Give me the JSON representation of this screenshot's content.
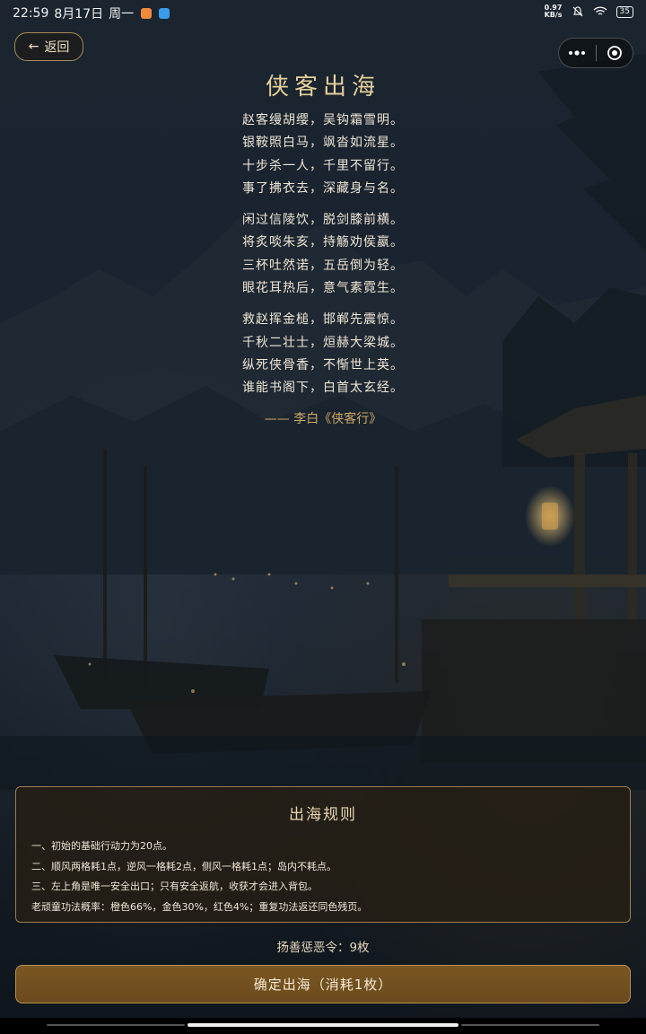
{
  "status_bar": {
    "time": "22:59",
    "date": "8月17日",
    "weekday": "周一",
    "net_speed_value": "0.97",
    "net_speed_unit": "KB/s",
    "battery": "35"
  },
  "header": {
    "back_arrow": "←",
    "back_label": "返回"
  },
  "poem": {
    "title": "侠客出海",
    "stanzas": [
      [
        "赵客缦胡缨，吴钩霜雪明。",
        "银鞍照白马，飒沓如流星。",
        "十步杀一人，千里不留行。",
        "事了拂衣去，深藏身与名。"
      ],
      [
        "闲过信陵饮，脱剑膝前横。",
        "将炙啖朱亥，持觞劝侯嬴。",
        "三杯吐然诺，五岳倒为轻。",
        "眼花耳热后，意气素霓生。"
      ],
      [
        "救赵挥金槌，邯郸先震惊。",
        "千秋二壮士，烜赫大梁城。",
        "纵死侠骨香，不惭世上英。",
        "谁能书阁下，白首太玄经。"
      ]
    ],
    "attribution": "—— 李白《侠客行》"
  },
  "rules": {
    "title": "出海规则",
    "items": [
      "一、初始的基础行动力为20点。",
      "二、顺风两格耗1点，逆风一格耗2点，侧风一格耗1点；岛内不耗点。",
      "三、左上角是唯一安全出口；只有安全返航，收获才会进入背包。",
      "老顽童功法概率：橙色66%，金色30%，红色4%；重复功法返还同色残页。"
    ]
  },
  "token_count": "扬善惩恶令：9枚",
  "confirm_label": "确定出海（消耗1枚）",
  "colors": {
    "accent_gold": "#e6cf9a",
    "button_brown": "#7a5624",
    "panel_border": "#9c7e4d"
  }
}
